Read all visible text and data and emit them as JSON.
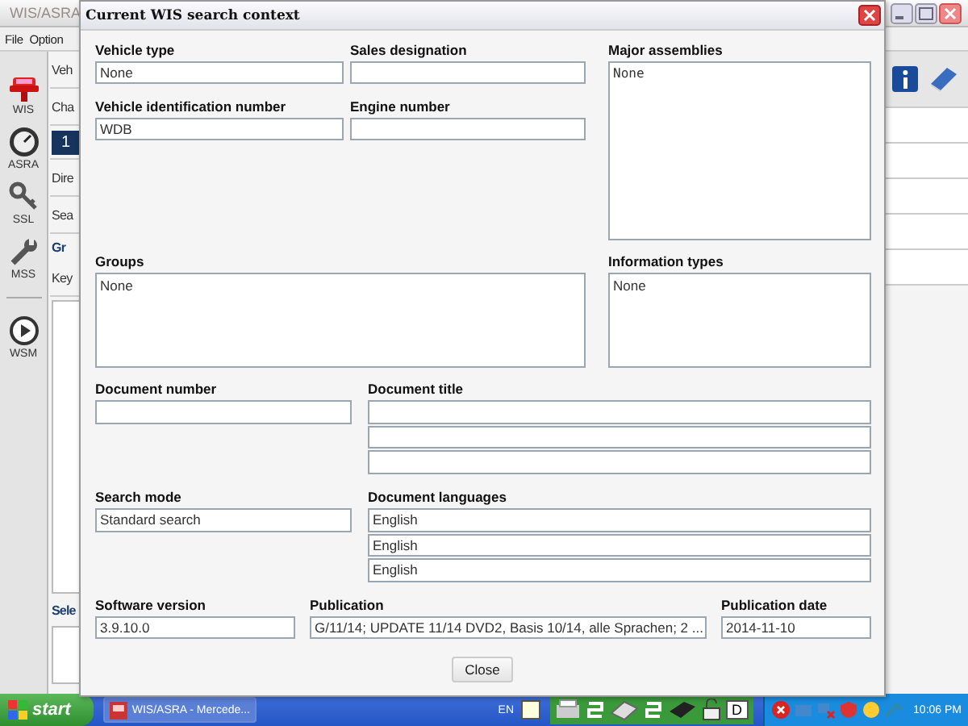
{
  "app": {
    "title": "WIS/ASRA",
    "menu": [
      "File",
      "Option"
    ],
    "sidebar": [
      {
        "label": "WIS",
        "kind": "car"
      },
      {
        "label": "ASRA",
        "kind": "gauge"
      },
      {
        "label": "SSL",
        "kind": "key"
      },
      {
        "label": "MSS",
        "kind": "wrench"
      },
      {
        "label": "WSM",
        "kind": "play"
      }
    ],
    "content": [
      {
        "text": "Veh",
        "kind": "row"
      },
      {
        "text": "Cha",
        "kind": "row"
      },
      {
        "text": "1",
        "kind": "tab"
      },
      {
        "text": "Dire",
        "kind": "row"
      },
      {
        "text": "Sea",
        "kind": "row"
      },
      {
        "text": "Gr",
        "kind": "heading"
      },
      {
        "text": "Key",
        "kind": "boxed"
      },
      {
        "text": "Sele",
        "kind": "heading-boxed"
      }
    ]
  },
  "dialog": {
    "title": "Current WIS search context",
    "fields": [
      {
        "label": "Vehicle type",
        "kind": "line",
        "values": [
          "None"
        ]
      },
      {
        "label": "Sales designation",
        "kind": "line"
      },
      {
        "label": "Major assemblies",
        "kind": "box",
        "values": [
          "None"
        ]
      },
      {
        "label": "Vehicle identification number",
        "kind": "line",
        "values": [
          "WDB"
        ]
      },
      {
        "label": "Engine number",
        "kind": "line"
      },
      {
        "label": "Groups",
        "kind": "box",
        "values": [
          "None"
        ]
      },
      {
        "label": "Information types",
        "kind": "box",
        "values": [
          "None"
        ]
      },
      {
        "label": "Document number",
        "kind": "line"
      },
      {
        "label": "Document title",
        "kind": "stack"
      },
      {
        "label": "Search mode",
        "kind": "line",
        "values": [
          "Standard search"
        ]
      },
      {
        "label": "Document languages",
        "kind": "stack",
        "values": [
          "English",
          "English",
          "English"
        ]
      },
      {
        "label": "Software version",
        "kind": "line",
        "values": [
          "3.9.10.0"
        ]
      },
      {
        "label": "Publication",
        "kind": "line",
        "values": [
          "G/11/14; UPDATE 11/14 DVD2, Basis 10/14, alle Sprachen; 2 ..."
        ]
      },
      {
        "label": "Publication date",
        "kind": "line",
        "values": [
          "2014-11-10"
        ]
      }
    ],
    "buttons": [
      "Close"
    ]
  },
  "taskbar": {
    "start": "start",
    "tasks": [
      "WIS/ASRA - Mercede..."
    ],
    "language": "EN",
    "drive": "D",
    "clock": "10:06 PM"
  }
}
